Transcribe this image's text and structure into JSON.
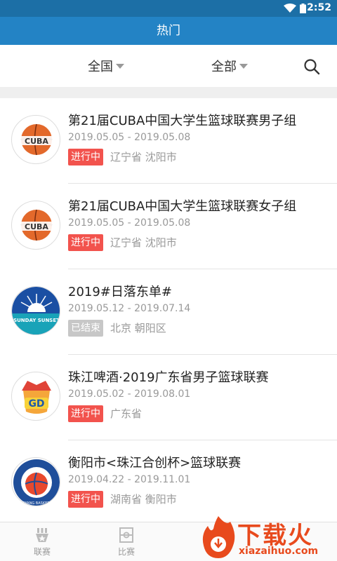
{
  "status_bar": {
    "time": "2:52"
  },
  "app_bar": {
    "title": "热门"
  },
  "filters": {
    "region": "全国",
    "category": "全部"
  },
  "events": [
    {
      "title": "第21届CUBA中国大学生篮球联赛男子组",
      "dates": "2019.05.05 - 2019.05.08",
      "status": "进行中",
      "location": "辽宁省 沈阳市",
      "logo_text": "CUBA"
    },
    {
      "title": "第21届CUBA中国大学生篮球联赛女子组",
      "dates": "2019.05.05 - 2019.05.08",
      "status": "进行中",
      "location": "辽宁省 沈阳市",
      "logo_text": "CUBA"
    },
    {
      "title": "2019#日落东单#",
      "dates": "2019.05.12 - 2019.07.14",
      "status": "已结束",
      "location": "北京 朝阳区",
      "logo_text": "SUNDAY SUNSET"
    },
    {
      "title": "珠江啤酒·2019广东省男子篮球联赛",
      "dates": "2019.05.02 - 2019.08.01",
      "status": "进行中",
      "location": "广东省",
      "logo_text": "GD"
    },
    {
      "title": "衡阳市<珠江合创杯>篮球联赛",
      "dates": "2019.04.22 - 2019.11.01",
      "status": "进行中",
      "location": "湖南省 衡阳市",
      "logo_text": "HENGYANG BASKETBALL"
    }
  ],
  "tabs": [
    {
      "label": "联赛"
    },
    {
      "label": "比赛"
    }
  ],
  "watermark": {
    "text": "下载火",
    "url": "xiazaihuo.com"
  }
}
